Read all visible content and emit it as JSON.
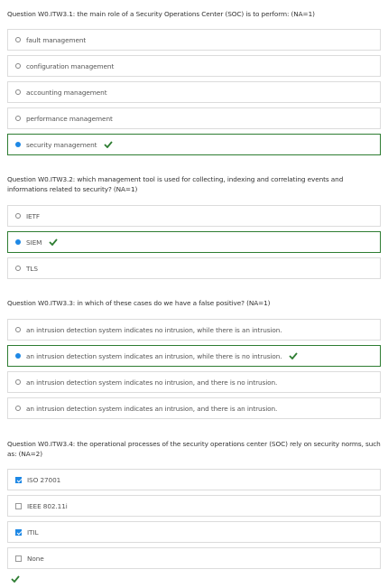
{
  "colors": {
    "selected_radio": "#1e88e5",
    "correct_border": "#2e7d32",
    "check": "#2e7d32",
    "option_border": "#dcdcdc"
  },
  "questions": [
    {
      "text": "Question W0.ITW3.1: the main role of a Security Operations Center (SOC) is to perform: (NA=1)",
      "options": [
        {
          "label": "fault management",
          "selected": false
        },
        {
          "label": "configuration management",
          "selected": false
        },
        {
          "label": "accounting management",
          "selected": false
        },
        {
          "label": "performance management",
          "selected": false
        },
        {
          "label": "security management",
          "selected": true,
          "correct_mark": "check-icon"
        }
      ]
    },
    {
      "text": "Question W0.ITW3.2: which management tool is used for collecting, indexing and correlating events and informations related to security? (NA=1)",
      "options": [
        {
          "label": "IETF",
          "selected": false
        },
        {
          "label": "SIEM",
          "selected": true,
          "correct_mark": "check-icon"
        },
        {
          "label": "TLS",
          "selected": false
        }
      ]
    },
    {
      "text": "Question W0.ITW3.3: in which of these cases do we have a false positive? (NA=1)",
      "options": [
        {
          "label": "an intrusion detection system indicates no intrusion, while there is an intrusion.",
          "selected": false
        },
        {
          "label": "an intrusion detection system indicates an intrusion, while there is no intrusion.",
          "selected": true,
          "correct_mark": "check-icon"
        },
        {
          "label": "an intrusion detection system indicates no intrusion, and there is no intrusion.",
          "selected": false
        },
        {
          "label": "an intrusion detection system indicates an intrusion, and there is an intrusion.",
          "selected": false
        }
      ]
    },
    {
      "text": "Question W0.ITW3.4: the operational processes of the security operations center (SOC) rely on security norms, such as: (NA=2)",
      "options": [
        {
          "label": "ISO 27001",
          "checked": true
        },
        {
          "label": "IEEE 802.11i",
          "checked": false
        },
        {
          "label": "ITIL",
          "checked": true
        },
        {
          "label": "None",
          "checked": false
        }
      ],
      "result_mark": "check-icon"
    }
  ]
}
